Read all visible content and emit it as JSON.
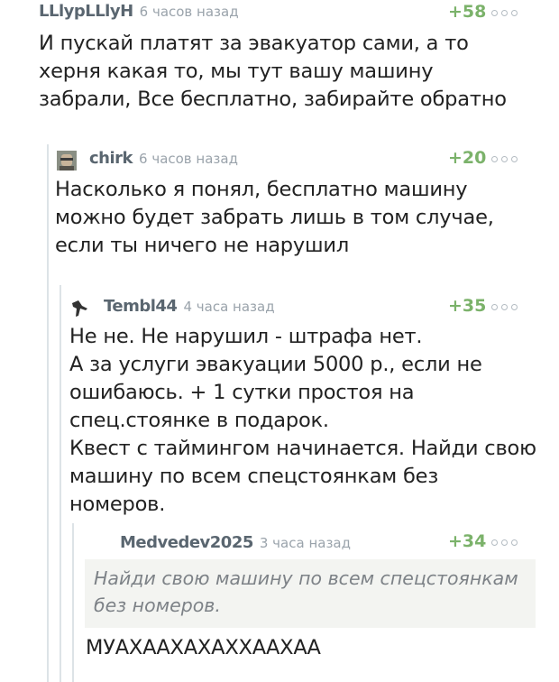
{
  "comments": [
    {
      "author": "LLlypLLlyH",
      "time": "6 часов назад",
      "rating": "+58",
      "text": "И пускай платят за эвакуатор сами, а то херня какая то, мы тут вашу машину забрали, Все бесплатно, забирайте обратно"
    },
    {
      "author": "chirk",
      "time": "6 часов назад",
      "rating": "+20",
      "text": "Насколько я понял, бесплатно машину можно будет забрать лишь в том случае, если ты ничего не нарушил"
    },
    {
      "author": "Tembl44",
      "time": "4 часа назад",
      "rating": "+35",
      "lines": [
        "Не не. Не нарушил - штрафа нет.",
        "А за услуги эвакуации 5000 р., если не ошибаюсь. + 1 сутки простоя на спец.стоянке в подарок.",
        "Квест с таймингом начинается. Найди свою машину по всем спецстоянкам без номеров."
      ]
    },
    {
      "author": "Medvedev2025",
      "time": "3 часа назад",
      "rating": "+34",
      "quote": "Найди свою машину по всем спецстоянкам без номеров.",
      "text": "МУАХААХАХАХХААХАА"
    }
  ],
  "colors": {
    "rating": "#7bb26a",
    "author": "#5a6670",
    "meta": "#9aa3ab"
  },
  "icons": [
    "more-options-icon",
    "avatar-icon"
  ]
}
